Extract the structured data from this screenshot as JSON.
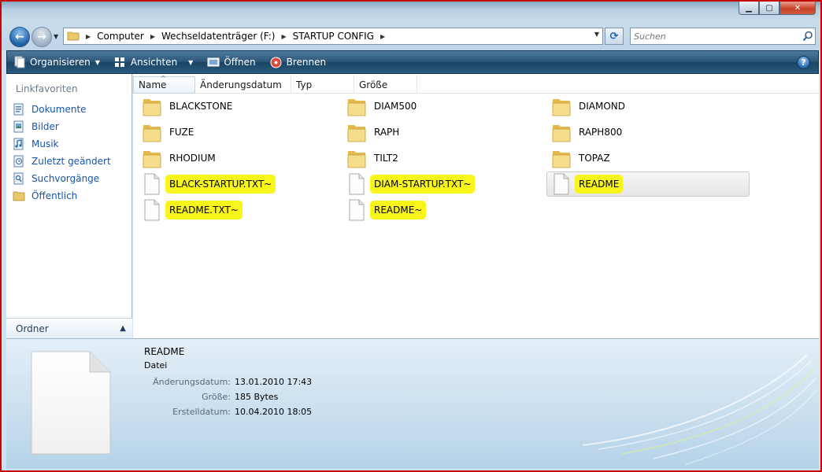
{
  "window": {
    "controls": {
      "minimize": "▁",
      "maximize": "▢",
      "close": "✕"
    }
  },
  "address": {
    "crumbs": [
      "Computer",
      "Wechseldatenträger (F:)",
      "STARTUP CONFIG"
    ],
    "search_placeholder": "Suchen"
  },
  "toolbar": {
    "organize": "Organisieren",
    "views": "Ansichten",
    "open": "Öffnen",
    "burn": "Brennen",
    "help": "?"
  },
  "nav": {
    "favorites_title": "Linkfavoriten",
    "items": [
      {
        "label": "Dokumente",
        "icon": "documents-icon"
      },
      {
        "label": "Bilder",
        "icon": "pictures-icon"
      },
      {
        "label": "Musik",
        "icon": "music-icon"
      },
      {
        "label": "Zuletzt geändert",
        "icon": "recent-icon"
      },
      {
        "label": "Suchvorgänge",
        "icon": "searches-icon"
      },
      {
        "label": "Öffentlich",
        "icon": "public-folder-icon"
      }
    ],
    "folders_label": "Ordner"
  },
  "columns": {
    "name": "Name",
    "modified": "Änderungsdatum",
    "type": "Typ",
    "size": "Größe"
  },
  "files": [
    {
      "name": "BLACKSTONE",
      "kind": "folder",
      "highlight": false
    },
    {
      "name": "DIAM500",
      "kind": "folder",
      "highlight": false
    },
    {
      "name": "DIAMOND",
      "kind": "folder",
      "highlight": false
    },
    {
      "name": "FUZE",
      "kind": "folder",
      "highlight": false
    },
    {
      "name": "RAPH",
      "kind": "folder",
      "highlight": false
    },
    {
      "name": "RAPH800",
      "kind": "folder",
      "highlight": false
    },
    {
      "name": "RHODIUM",
      "kind": "folder",
      "highlight": false
    },
    {
      "name": "TILT2",
      "kind": "folder",
      "highlight": false
    },
    {
      "name": "TOPAZ",
      "kind": "folder",
      "highlight": false
    },
    {
      "name": "BLACK-STARTUP.TXT~",
      "kind": "file",
      "highlight": true
    },
    {
      "name": "DIAM-STARTUP.TXT~",
      "kind": "file",
      "highlight": true
    },
    {
      "name": "README",
      "kind": "file",
      "highlight": true,
      "selected": true
    },
    {
      "name": "README.TXT~",
      "kind": "file",
      "highlight": true
    },
    {
      "name": "README~",
      "kind": "file",
      "highlight": true
    }
  ],
  "details": {
    "name": "README",
    "type": "Datei",
    "rows": [
      {
        "key": "Änderungsdatum:",
        "value": "13.01.2010 17:43"
      },
      {
        "key": "Größe:",
        "value": "185 Bytes"
      },
      {
        "key": "Erstelldatum:",
        "value": "10.04.2010 18:05"
      }
    ]
  },
  "colors": {
    "highlight": "#f7f51a",
    "link": "#1556a8",
    "toolbar": "#2c5678"
  }
}
